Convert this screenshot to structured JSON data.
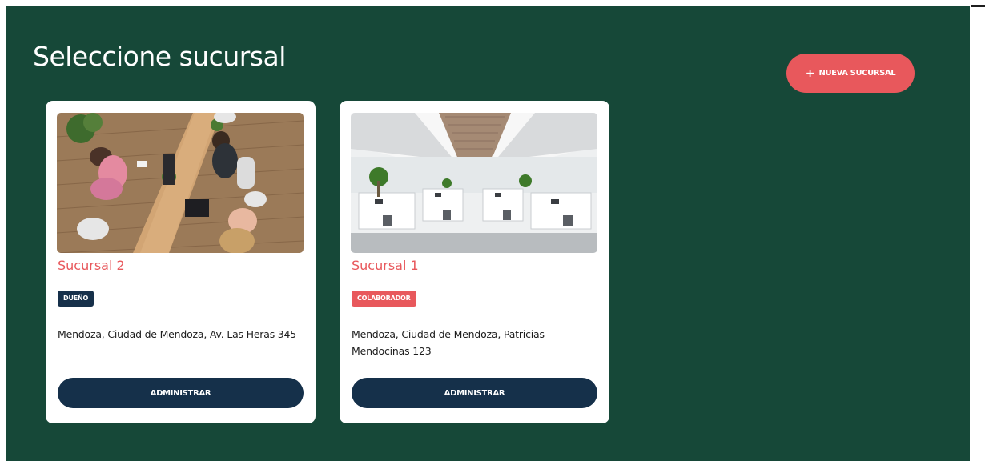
{
  "header": {
    "title": "Seleccione sucursal",
    "new_branch_button": {
      "icon": "plus-icon",
      "icon_glyph": "+",
      "label": "NUEVA SUCURSAL"
    }
  },
  "branches": [
    {
      "name": "Sucursal 2",
      "role": "DUEÑO",
      "address": "Mendoza, Ciudad de Mendoza, Av. Las Heras 345",
      "photo": "coworking-office-photo",
      "action_label": "ADMINISTRAR"
    },
    {
      "name": "Sucursal 1",
      "role": "COLABORADOR",
      "address": "Mendoza, Ciudad de Mendoza, Patricias Mendocinas 123",
      "photo": "open-plan-office-photo",
      "action_label": "ADMINISTRAR"
    }
  ],
  "colors": {
    "background": "#164838",
    "accent": "#e8585c",
    "navy": "#15304a",
    "card": "#ffffff"
  }
}
